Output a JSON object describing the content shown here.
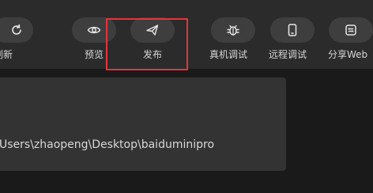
{
  "toolbar": {
    "buttons": [
      {
        "id": "refresh",
        "label": "刷新",
        "icon": "refresh-icon"
      },
      {
        "id": "preview",
        "label": "预览",
        "icon": "eye-icon"
      },
      {
        "id": "publish",
        "label": "发布",
        "icon": "paper-plane-icon"
      },
      {
        "id": "device_debug",
        "label": "真机调试",
        "icon": "bug-icon"
      },
      {
        "id": "remote_debug",
        "label": "远程调试",
        "icon": "phone-icon"
      },
      {
        "id": "share_web",
        "label": "分享Web",
        "icon": "share-link-icon"
      }
    ]
  },
  "panel": {
    "path": "Users\\zhaopeng\\Desktop\\baiduminipro"
  },
  "colors": {
    "background": "#1a1a1a",
    "toolbar": "#2b2b2b",
    "pill": "#3e3e3e",
    "panel": "#333333",
    "highlight": "#e5343b",
    "text": "#d6d6d6"
  }
}
